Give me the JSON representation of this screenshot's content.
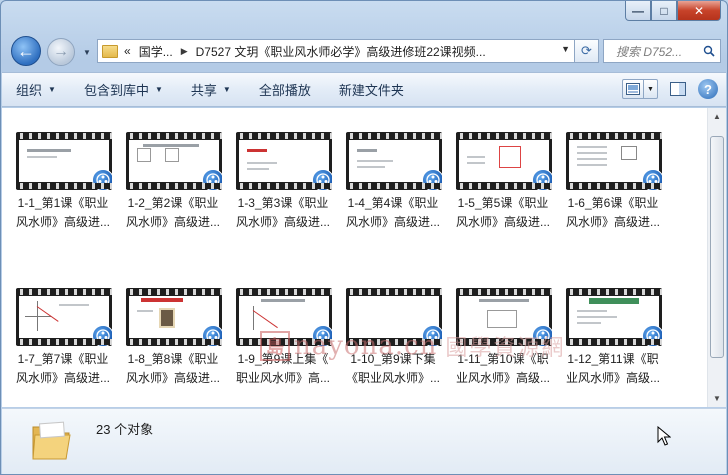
{
  "window": {
    "caption": {
      "minimize": "—",
      "maximize": "□",
      "close": "✕"
    }
  },
  "address": {
    "segments": [
      "«",
      "国学...",
      "D7527 文玥《职业风水师必学》高级进修班22课视频..."
    ],
    "search_placeholder": "搜索 D752..."
  },
  "toolbar": {
    "items": [
      {
        "label": "组织",
        "dropdown": true
      },
      {
        "label": "包含到库中",
        "dropdown": true
      },
      {
        "label": "共享",
        "dropdown": true
      },
      {
        "label": "全部播放",
        "dropdown": false
      },
      {
        "label": "新建文件夹",
        "dropdown": false
      }
    ]
  },
  "files": [
    {
      "line1": "1-1_第1课《职业",
      "line2": "风水师》高级进..."
    },
    {
      "line1": "1-2_第2课《职业",
      "line2": "风水师》高级进..."
    },
    {
      "line1": "1-3_第3课《职业",
      "line2": "风水师》高级进..."
    },
    {
      "line1": "1-4_第4课《职业",
      "line2": "风水师》高级进..."
    },
    {
      "line1": "1-5_第5课《职业",
      "line2": "风水师》高级进..."
    },
    {
      "line1": "1-6_第6课《职业",
      "line2": "风水师》高级进..."
    },
    {
      "line1": "1-7_第7课《职业",
      "line2": "风水师》高级进..."
    },
    {
      "line1": "1-8_第8课《职业",
      "line2": "风水师》高级进..."
    },
    {
      "line1": "1-9_第9课上集《",
      "line2": "职业风水师》高..."
    },
    {
      "line1": "1-10_第9课下集",
      "line2": "《职业风水师》..."
    },
    {
      "line1": "1-11_第10课《职",
      "line2": "业风水师》高级..."
    },
    {
      "line1": "1-12_第11课《职",
      "line2": "业风水师》高级..."
    }
  ],
  "watermark": {
    "seal": "島",
    "latin": "nayona.cn",
    "chinese": "國學資源網"
  },
  "status": {
    "count": "23 个对象"
  }
}
